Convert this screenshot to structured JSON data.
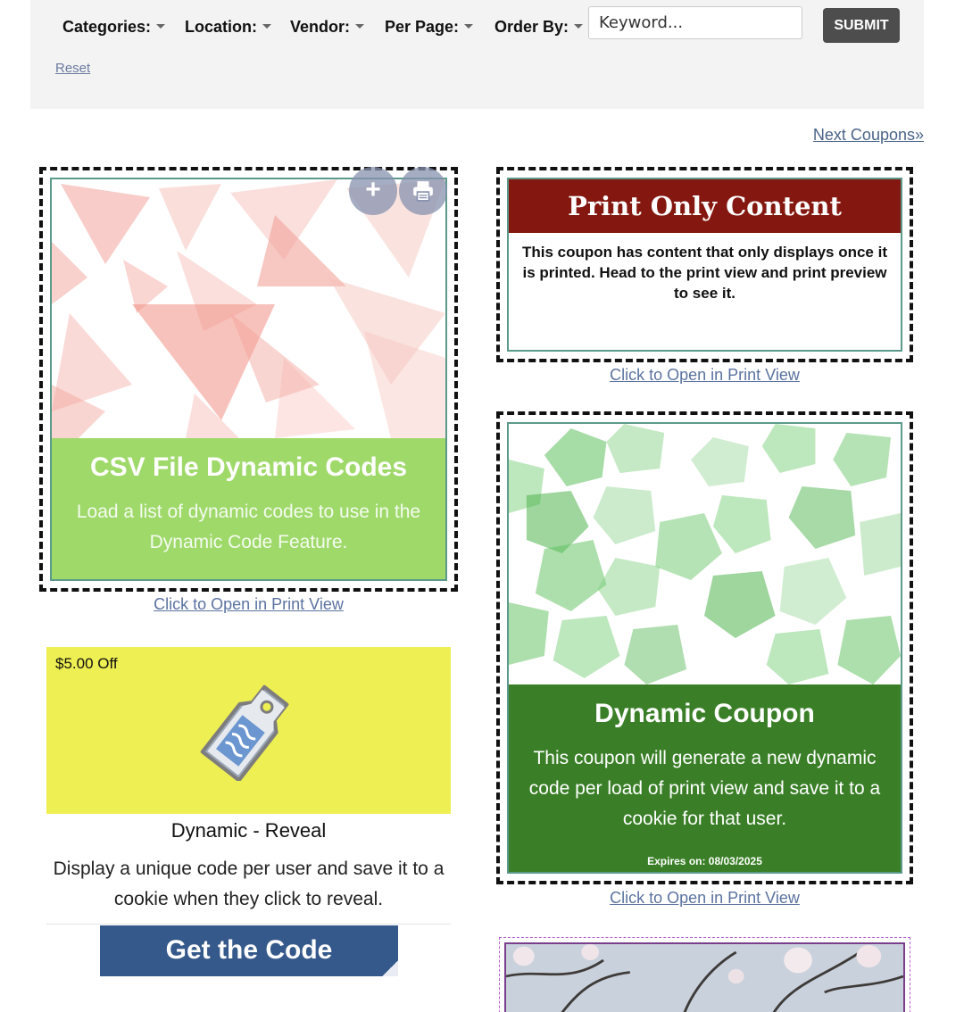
{
  "filters": {
    "categories": "Categories:",
    "location": "Location:",
    "vendor": "Vendor:",
    "per_page": "Per Page:",
    "order_by": "Order By:",
    "keyword_placeholder": "Keyword...",
    "submit": "SUBMIT",
    "reset": "Reset"
  },
  "pagination": {
    "next": "Next Coupons»"
  },
  "coupons": {
    "csv": {
      "title": "CSV File Dynamic Codes",
      "description": "Load a list of dynamic codes to use in the Dynamic Code Feature.",
      "link": "Click to Open in Print View",
      "add_icon": "plus-icon",
      "print_icon": "printer-icon",
      "panel_color": "#9fd96a"
    },
    "print_only": {
      "title": "Print Only Content",
      "description": "This coupon has content that only displays once it is printed. Head to the print view and print preview to see it.",
      "link": "Click to Open in Print View",
      "header_color": "#841810"
    },
    "dynamic": {
      "title": "Dynamic Coupon",
      "description": "This coupon will generate a new dynamic code per load of print view and save it to a cookie for that user.",
      "expires": "Expires on: 08/03/2025",
      "link": "Click to Open in Print View",
      "panel_color": "#3a7f27"
    },
    "reveal": {
      "price": "$5.00 Off",
      "title": "Dynamic - Reveal",
      "description": "Display a unique code per user and save it to a cookie when they click to reveal.",
      "button": "Get the Code",
      "icon": "price-tag-icon",
      "background_color": "#eeef52"
    }
  }
}
